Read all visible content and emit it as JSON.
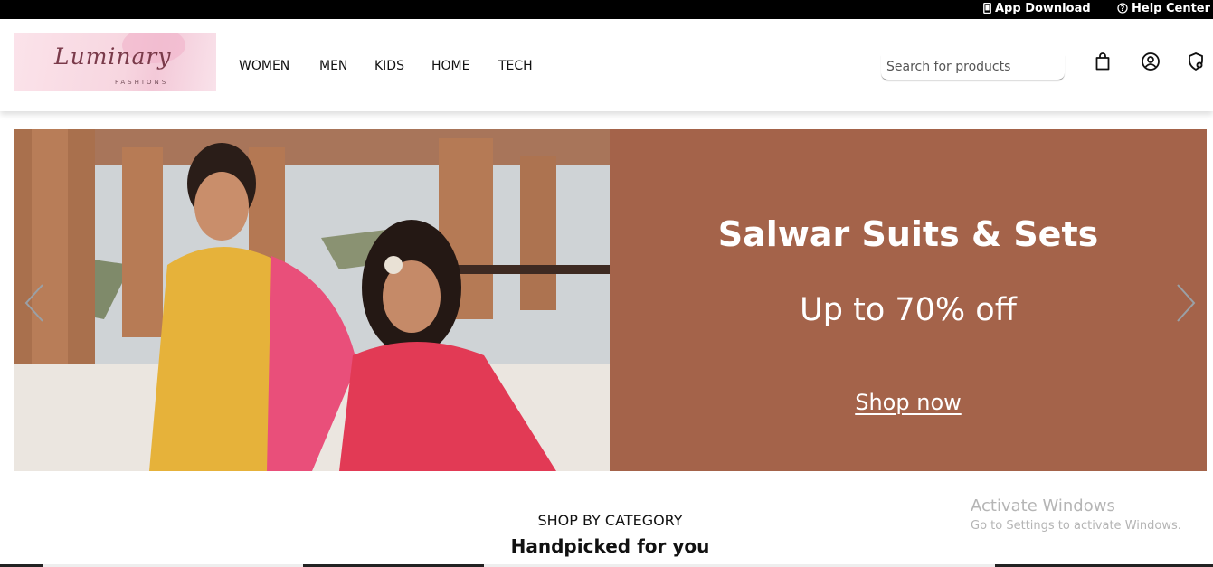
{
  "topbar": {
    "app_download": "App Download",
    "help_center": "Help Center"
  },
  "header": {
    "logo_text": "Luminary",
    "logo_subtext": "FASHIONS",
    "nav": [
      "WOMEN",
      "MEN",
      "KIDS",
      "HOME",
      "TECH"
    ],
    "search_placeholder": "Search for products",
    "icons": [
      "shopping-bag-icon",
      "account-icon",
      "wishlist-shield-icon"
    ]
  },
  "banner": {
    "title": "Salwar Suits & Sets",
    "offer": "Up to 70% off",
    "cta": "Shop now",
    "promo_color": "#a4634a"
  },
  "category": {
    "title": "SHOP BY CATEGORY",
    "subtitle": "Handpicked for you"
  },
  "watermark": {
    "title": "Activate Windows",
    "subtitle": "Go to Settings to activate Windows."
  }
}
